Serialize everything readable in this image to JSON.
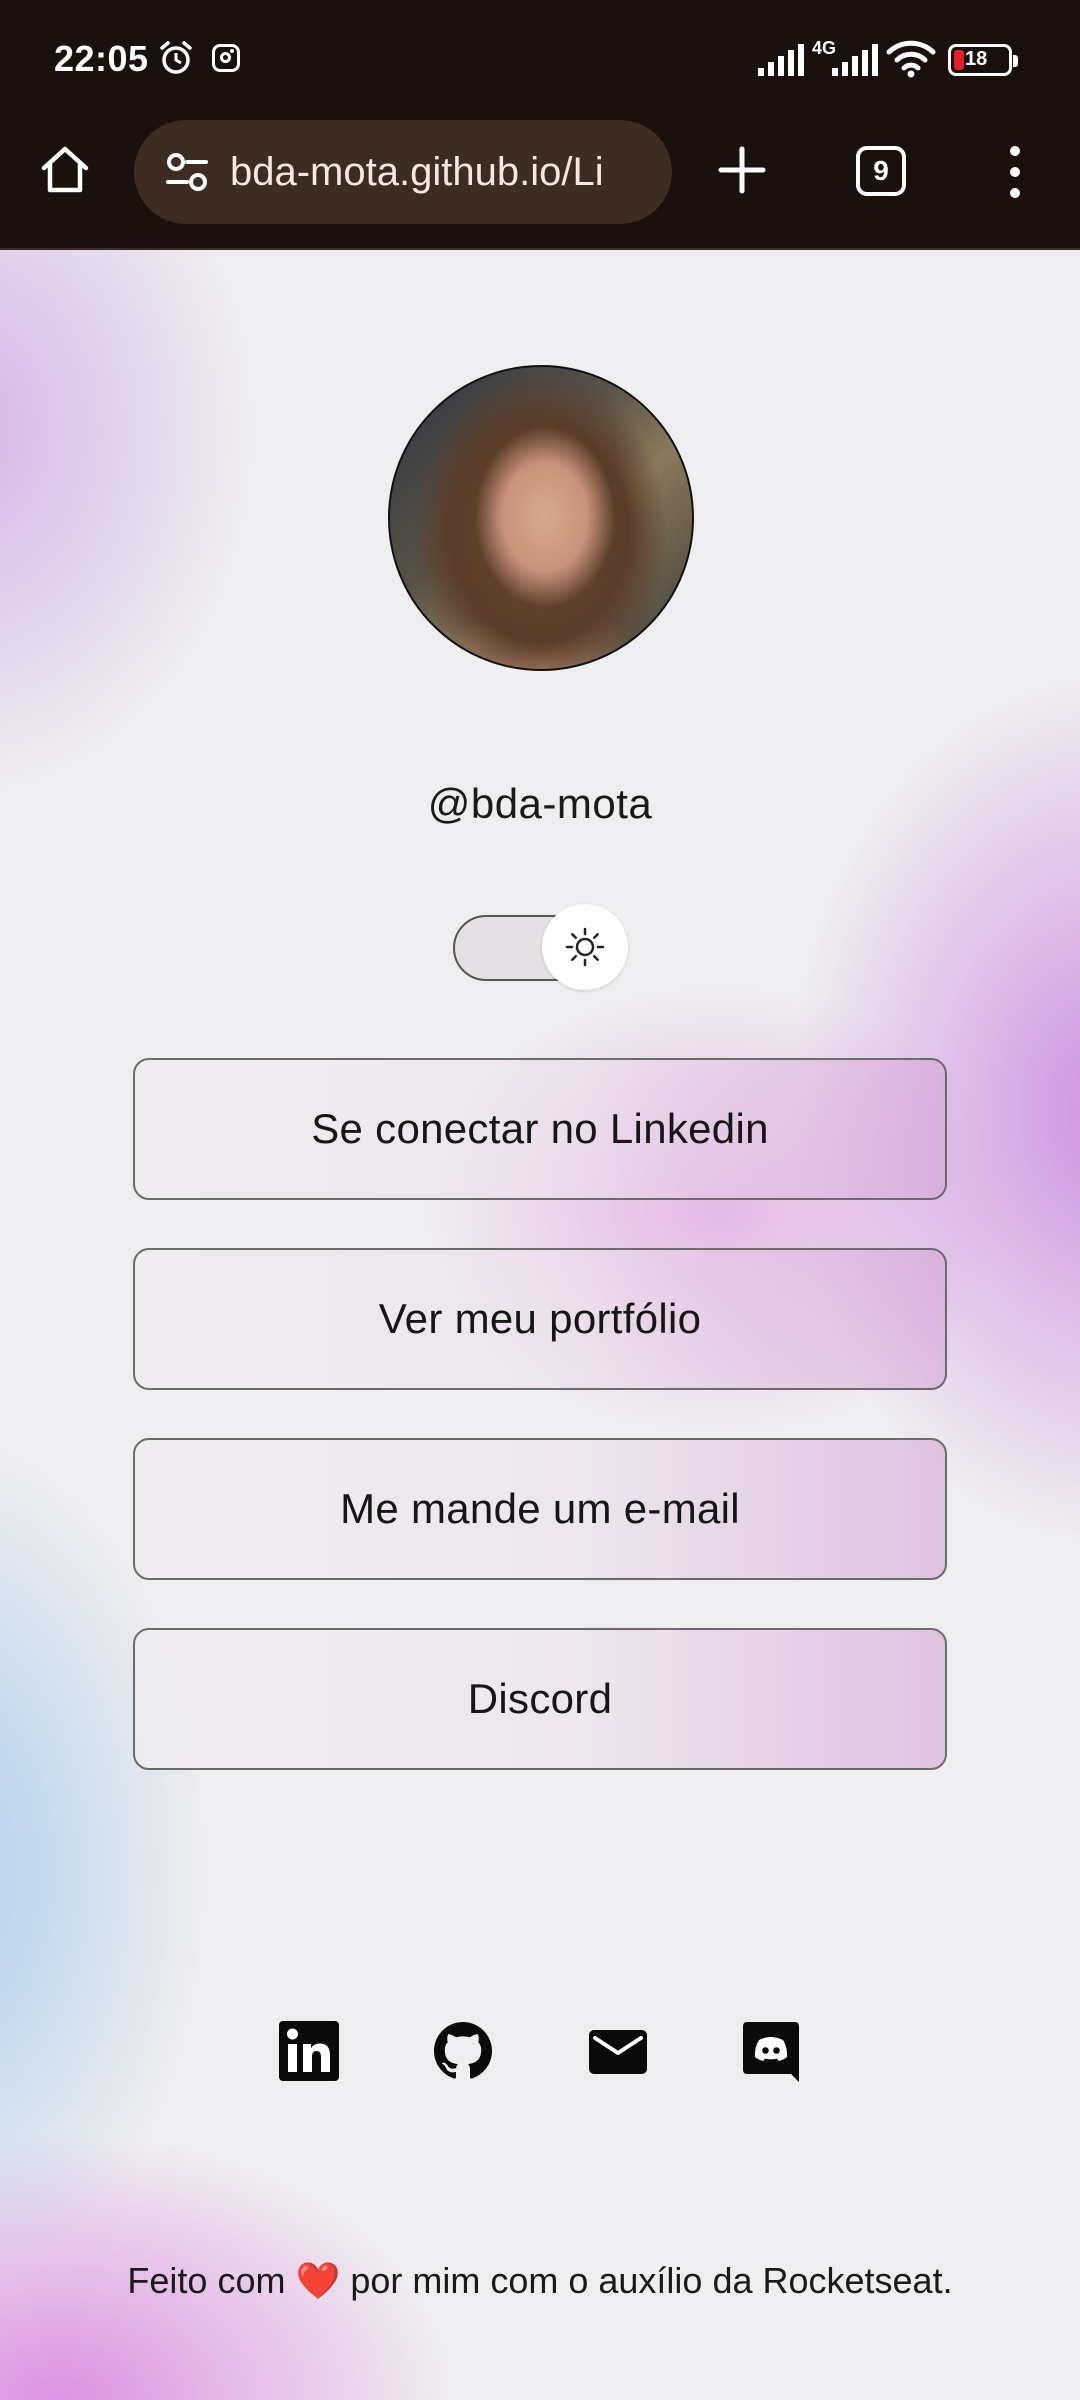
{
  "status_bar": {
    "time": "22:05",
    "network": "4G",
    "battery_level": "18",
    "battery_color": "#e0202a",
    "icons": [
      "alarm-icon",
      "instagram-icon",
      "signal-icon",
      "signal-icon",
      "wifi-icon",
      "battery-icon"
    ]
  },
  "browser": {
    "url": "bda-mota.github.io/Li",
    "tab_count": "9",
    "icons": [
      "home-icon",
      "site-settings-icon",
      "new-tab-icon",
      "tabs-icon",
      "more-menu-icon"
    ]
  },
  "profile": {
    "username": "@bda-mota",
    "theme_toggle_icon": "sun-icon"
  },
  "links": [
    {
      "label": "Se conectar no Linkedin"
    },
    {
      "label": "Ver meu portfólio"
    },
    {
      "label": "Me mande um e-mail"
    },
    {
      "label": "Discord"
    }
  ],
  "social_icons": [
    "linkedin-icon",
    "github-icon",
    "email-icon",
    "discord-icon"
  ],
  "footer": {
    "before_heart": "Feito com",
    "heart": "❤️",
    "after_heart": "por mim com o auxílio da Rocketseat."
  }
}
